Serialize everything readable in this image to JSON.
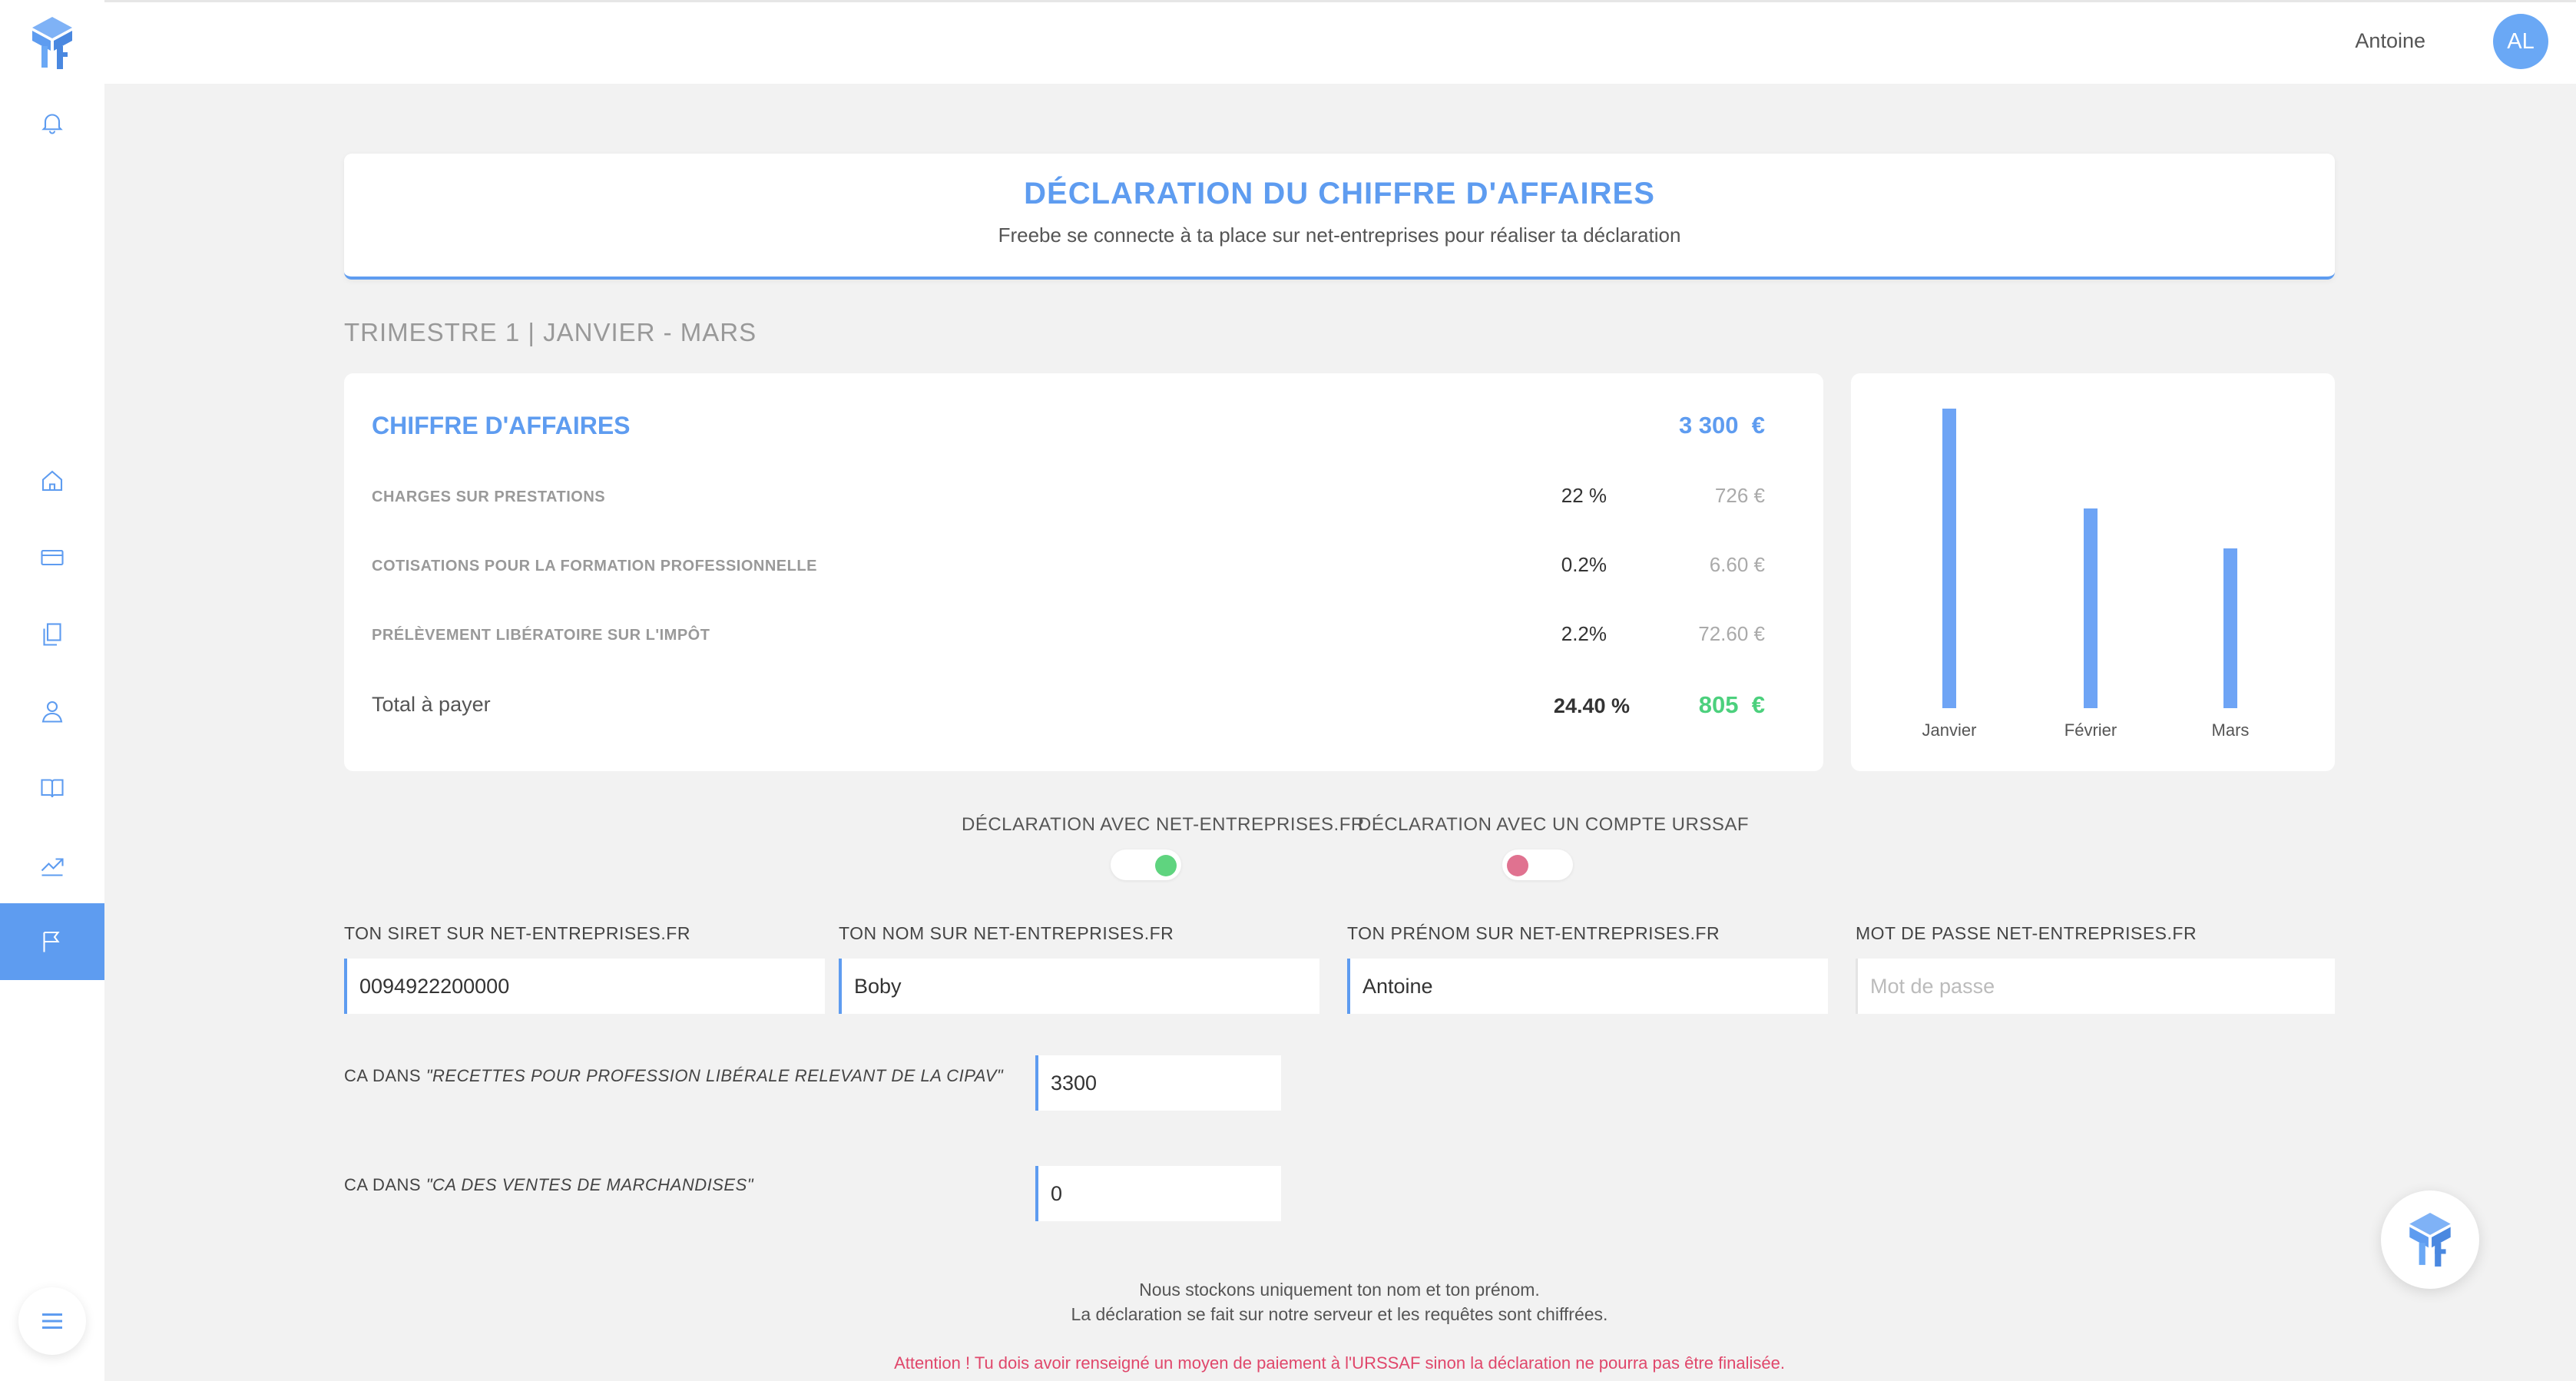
{
  "user": {
    "name": "Antoine",
    "initials": "AL"
  },
  "sidebar": {
    "items": [
      {
        "icon": "bell-icon"
      },
      {
        "icon": "home-icon"
      },
      {
        "icon": "credit-card-icon"
      },
      {
        "icon": "documents-icon"
      },
      {
        "icon": "user-icon"
      },
      {
        "icon": "book-icon"
      },
      {
        "icon": "chart-line-icon"
      },
      {
        "icon": "flag-icon",
        "active": true
      }
    ],
    "menu_icon": "hamburger-icon"
  },
  "header": {
    "title": "DÉCLARATION DU CHIFFRE D'AFFAIRES",
    "subtitle": "Freebe se connecte à ta place sur net-entreprises pour réaliser ta déclaration"
  },
  "quarter": "TRIMESTRE 1 | JANVIER - MARS",
  "revenue": {
    "title": "CHIFFRE D'AFFAIRES",
    "value": "3 300  €",
    "rows": [
      {
        "label": "CHARGES SUR PRESTATIONS",
        "pct": "22 %",
        "amount": "726 €"
      },
      {
        "label": "COTISATIONS POUR LA FORMATION PROFESSIONNELLE",
        "pct": "0.2%",
        "amount": "6.60 €"
      },
      {
        "label": "PRÉLÈVEMENT LIBÉRATOIRE SUR L'IMPÔT",
        "pct": "2.2%",
        "amount": "72.60 €"
      }
    ],
    "total": {
      "label": "Total à payer",
      "pct": "24.40 %",
      "amount": "805  €"
    }
  },
  "chart_data": {
    "type": "bar",
    "categories": [
      "Janvier",
      "Février",
      "Mars"
    ],
    "values": [
      1500,
      1000,
      800
    ],
    "ylim": [
      0,
      1500
    ],
    "color": "#6ea4f5",
    "grid": false
  },
  "toggles": {
    "net_entreprises": {
      "label": "DÉCLARATION AVEC NET-ENTREPRISES.FR",
      "on": true,
      "color": "#5fd47f"
    },
    "urssaf": {
      "label": "DÉCLARATION AVEC UN COMPTE URSSAF",
      "on": false,
      "color": "#e07290"
    }
  },
  "form": {
    "siret": {
      "label": "TON SIRET SUR NET-ENTREPRISES.FR",
      "value": "0094922200000"
    },
    "nom": {
      "label": "TON NOM SUR NET-ENTREPRISES.FR",
      "value": "Boby"
    },
    "prenom": {
      "label": "TON PRÉNOM SUR NET-ENTREPRISES.FR",
      "value": "Antoine"
    },
    "password": {
      "label": "MOT DE PASSE NET-ENTREPRISES.FR",
      "placeholder": "Mot de passe"
    },
    "ca_recettes": {
      "label_prefix": "CA DANS ",
      "label_quote": "\"RECETTES POUR PROFESSION LIBÉRALE RELEVANT DE LA CIPAV\"",
      "value": "3300"
    },
    "ca_ventes": {
      "label_prefix": "CA DANS ",
      "label_quote": "\"CA DES VENTES DE MARCHANDISES\"",
      "value": "0"
    }
  },
  "notice": {
    "line1": "Nous stockons uniquement ton nom et ton prénom.",
    "line2": "La déclaration se fait sur notre serveur et les requêtes sont chiffrées."
  },
  "warning": "Attention ! Tu dois avoir renseigné un moyen de paiement à l'URSSAF sinon la déclaration ne pourra pas être finalisée.",
  "colors": {
    "accent": "#5e9cf0",
    "success": "#4cd07d",
    "danger": "#e0476b"
  }
}
